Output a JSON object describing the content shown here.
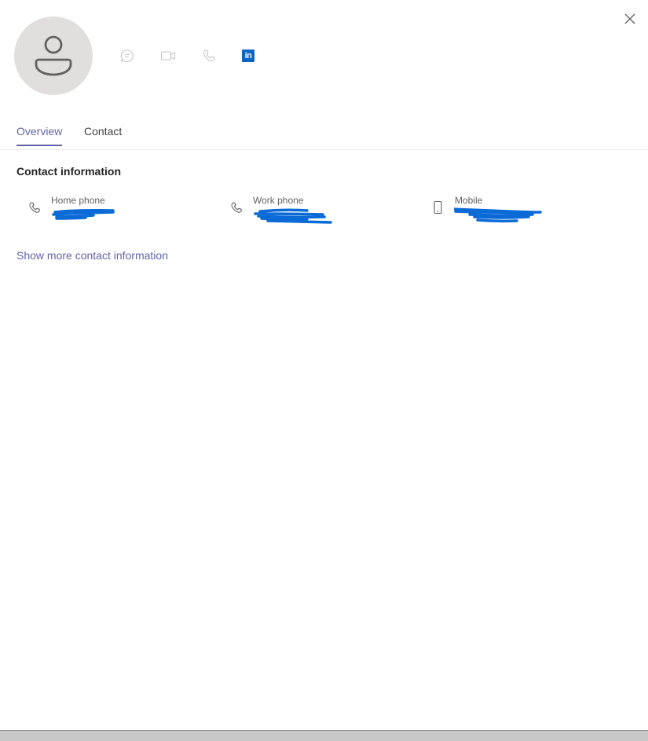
{
  "header": {
    "close_icon": "close-icon",
    "avatar_icon": "person-icon",
    "actions": [
      {
        "name": "chat-icon"
      },
      {
        "name": "video-call-icon"
      },
      {
        "name": "audio-call-icon"
      },
      {
        "name": "linkedin-icon",
        "text": "in",
        "color": "#0a66c2"
      }
    ]
  },
  "tabs": [
    {
      "label": "Overview",
      "active": true
    },
    {
      "label": "Contact",
      "active": false
    }
  ],
  "contact_section": {
    "heading": "Contact information",
    "items": [
      {
        "label": "Home phone",
        "icon": "phone-icon"
      },
      {
        "label": "Work phone",
        "icon": "phone-icon"
      },
      {
        "label": "Mobile",
        "icon": "mobile-phone-icon"
      }
    ],
    "show_more_label": "Show more contact information"
  },
  "colors": {
    "accent": "#6264a7",
    "redaction": "#0a6ad6",
    "avatar_bg": "#e1dfdd"
  }
}
